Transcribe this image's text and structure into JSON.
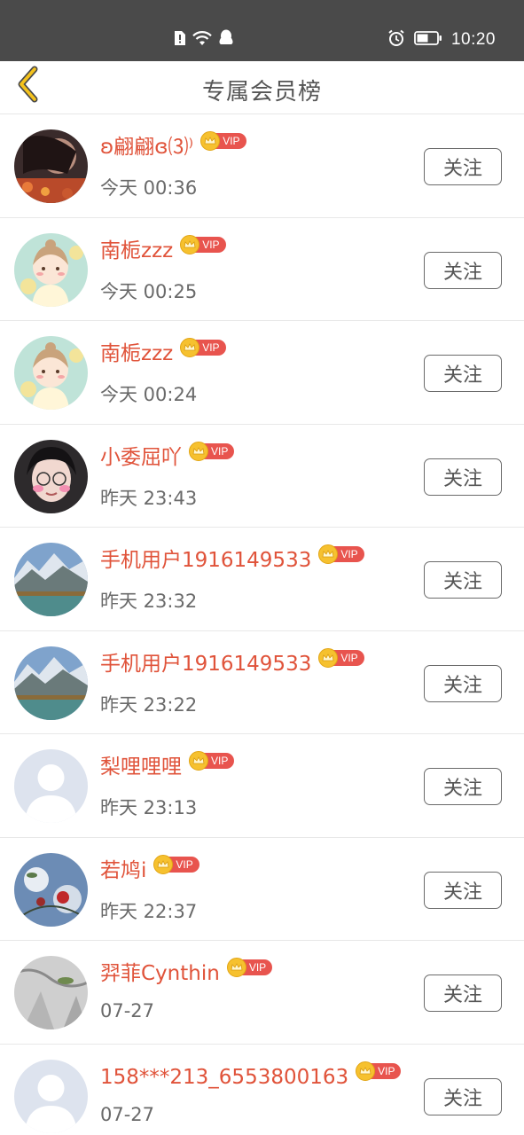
{
  "status_bar": {
    "time": "10:20",
    "icons": [
      "sim-alert-icon",
      "wifi-icon",
      "qq-icon",
      "alarm-icon",
      "battery-icon"
    ]
  },
  "header": {
    "title": "专属会员榜",
    "back_icon": "chevron-left-icon",
    "accent_color": "#f4c21d"
  },
  "badge": {
    "vip_label": "VIP",
    "crown_color": "#f6c12f",
    "tag_color": "#e8544e"
  },
  "members": [
    {
      "name": "ʚ翩翩ɞ⑶⁾",
      "time": "今天 00:36",
      "follow": "关注",
      "avatar": "photo-dark-hair"
    },
    {
      "name": "南栀zzz",
      "time": "今天 00:25",
      "follow": "关注",
      "avatar": "cartoon-girl"
    },
    {
      "name": "南栀zzz",
      "time": "今天 00:24",
      "follow": "关注",
      "avatar": "cartoon-girl"
    },
    {
      "name": "小委屈吖",
      "time": "昨天 23:43",
      "follow": "关注",
      "avatar": "girl-glasses"
    },
    {
      "name": "手机用户1916149533",
      "time": "昨天 23:32",
      "follow": "关注",
      "avatar": "mountain-lake"
    },
    {
      "name": "手机用户1916149533",
      "time": "昨天 23:22",
      "follow": "关注",
      "avatar": "mountain-lake"
    },
    {
      "name": "梨哩哩哩",
      "time": "昨天 23:13",
      "follow": "关注",
      "avatar": "default-person"
    },
    {
      "name": "若鸠i",
      "time": "昨天 22:37",
      "follow": "关注",
      "avatar": "flowers-sky"
    },
    {
      "name": "羿菲Cynthin",
      "time": "07-27",
      "follow": "关注",
      "avatar": "gray-sketch"
    },
    {
      "name": "158***213_6553800163",
      "time": "07-27",
      "follow": "关注",
      "avatar": "default-person"
    }
  ]
}
